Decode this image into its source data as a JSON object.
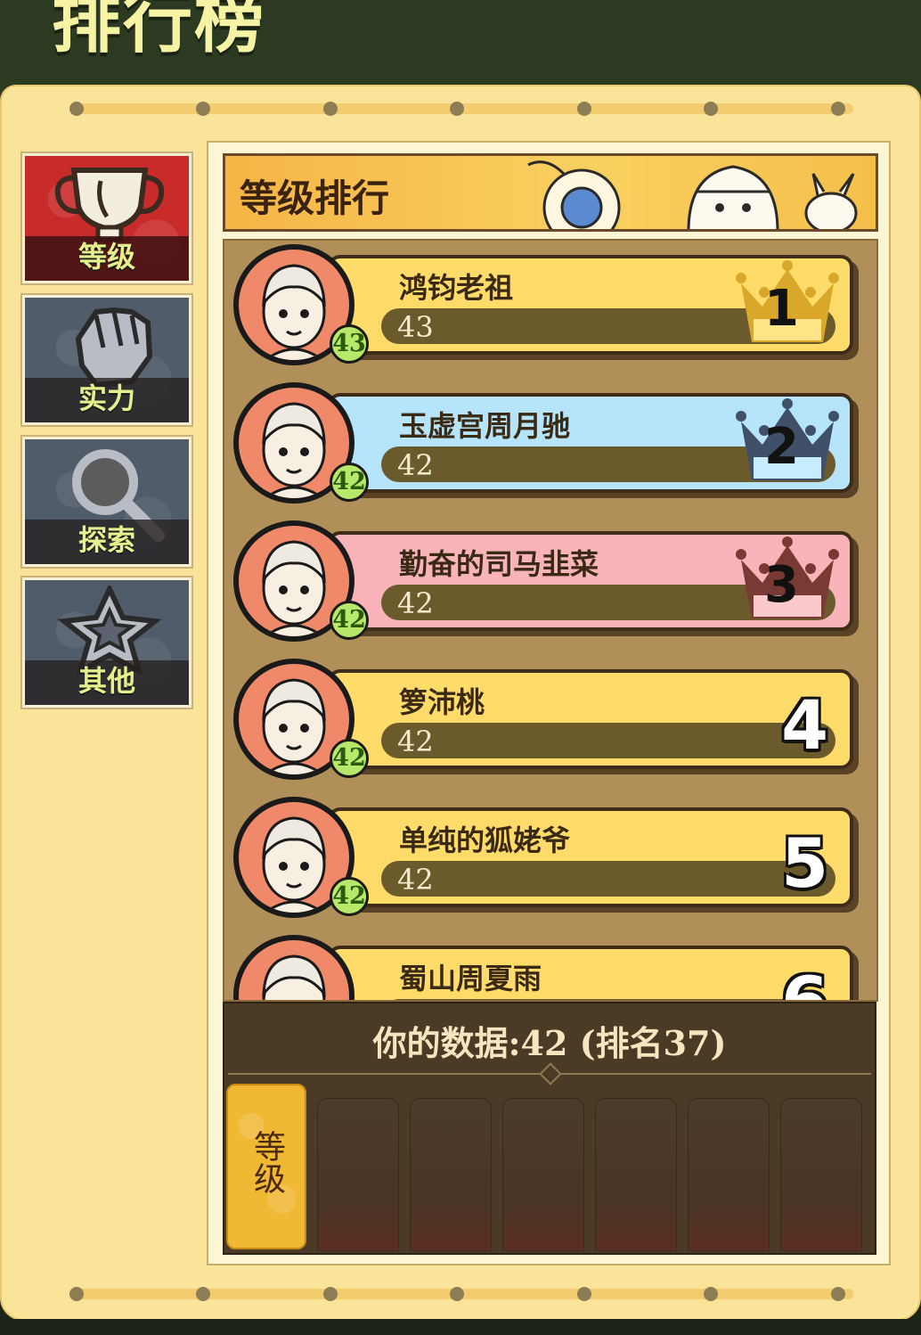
{
  "title": "排行榜",
  "side_tabs": [
    {
      "label": "等级",
      "icon": "trophy-icon",
      "active": true
    },
    {
      "label": "实力",
      "icon": "fist-icon",
      "active": false
    },
    {
      "label": "探索",
      "icon": "magnifier-icon",
      "active": false
    },
    {
      "label": "其他",
      "icon": "star-icon",
      "active": false
    }
  ],
  "board": {
    "title": "等级排行",
    "rows": [
      {
        "rank": "1",
        "name": "鸿钧老祖",
        "level": "43",
        "badge": "43",
        "style": "gold",
        "crown_color": "#d9a82a"
      },
      {
        "rank": "2",
        "name": "玉虚宫周月驰",
        "level": "42",
        "badge": "42",
        "style": "blue",
        "crown_color": "#3f5068"
      },
      {
        "rank": "3",
        "name": "勤奋的司马韭菜",
        "level": "42",
        "badge": "42",
        "style": "pink",
        "crown_color": "#7a3a34"
      },
      {
        "rank": "4",
        "name": "箩沛桃",
        "level": "42",
        "badge": "42",
        "style": "plain"
      },
      {
        "rank": "5",
        "name": "单纯的狐姥爷",
        "level": "42",
        "badge": "42",
        "style": "plain"
      },
      {
        "rank": "6",
        "name": "蜀山周夏雨",
        "level": "",
        "badge": "",
        "style": "plain"
      }
    ]
  },
  "my_data": {
    "text": "你的数据:42 (排名37)",
    "active_stat_tab": "等级"
  },
  "colors": {
    "accent_title": "#f6f3a4",
    "panel": "#fae49a",
    "active_tab": "#c92a2a",
    "level_badge": "#b8e86a"
  }
}
